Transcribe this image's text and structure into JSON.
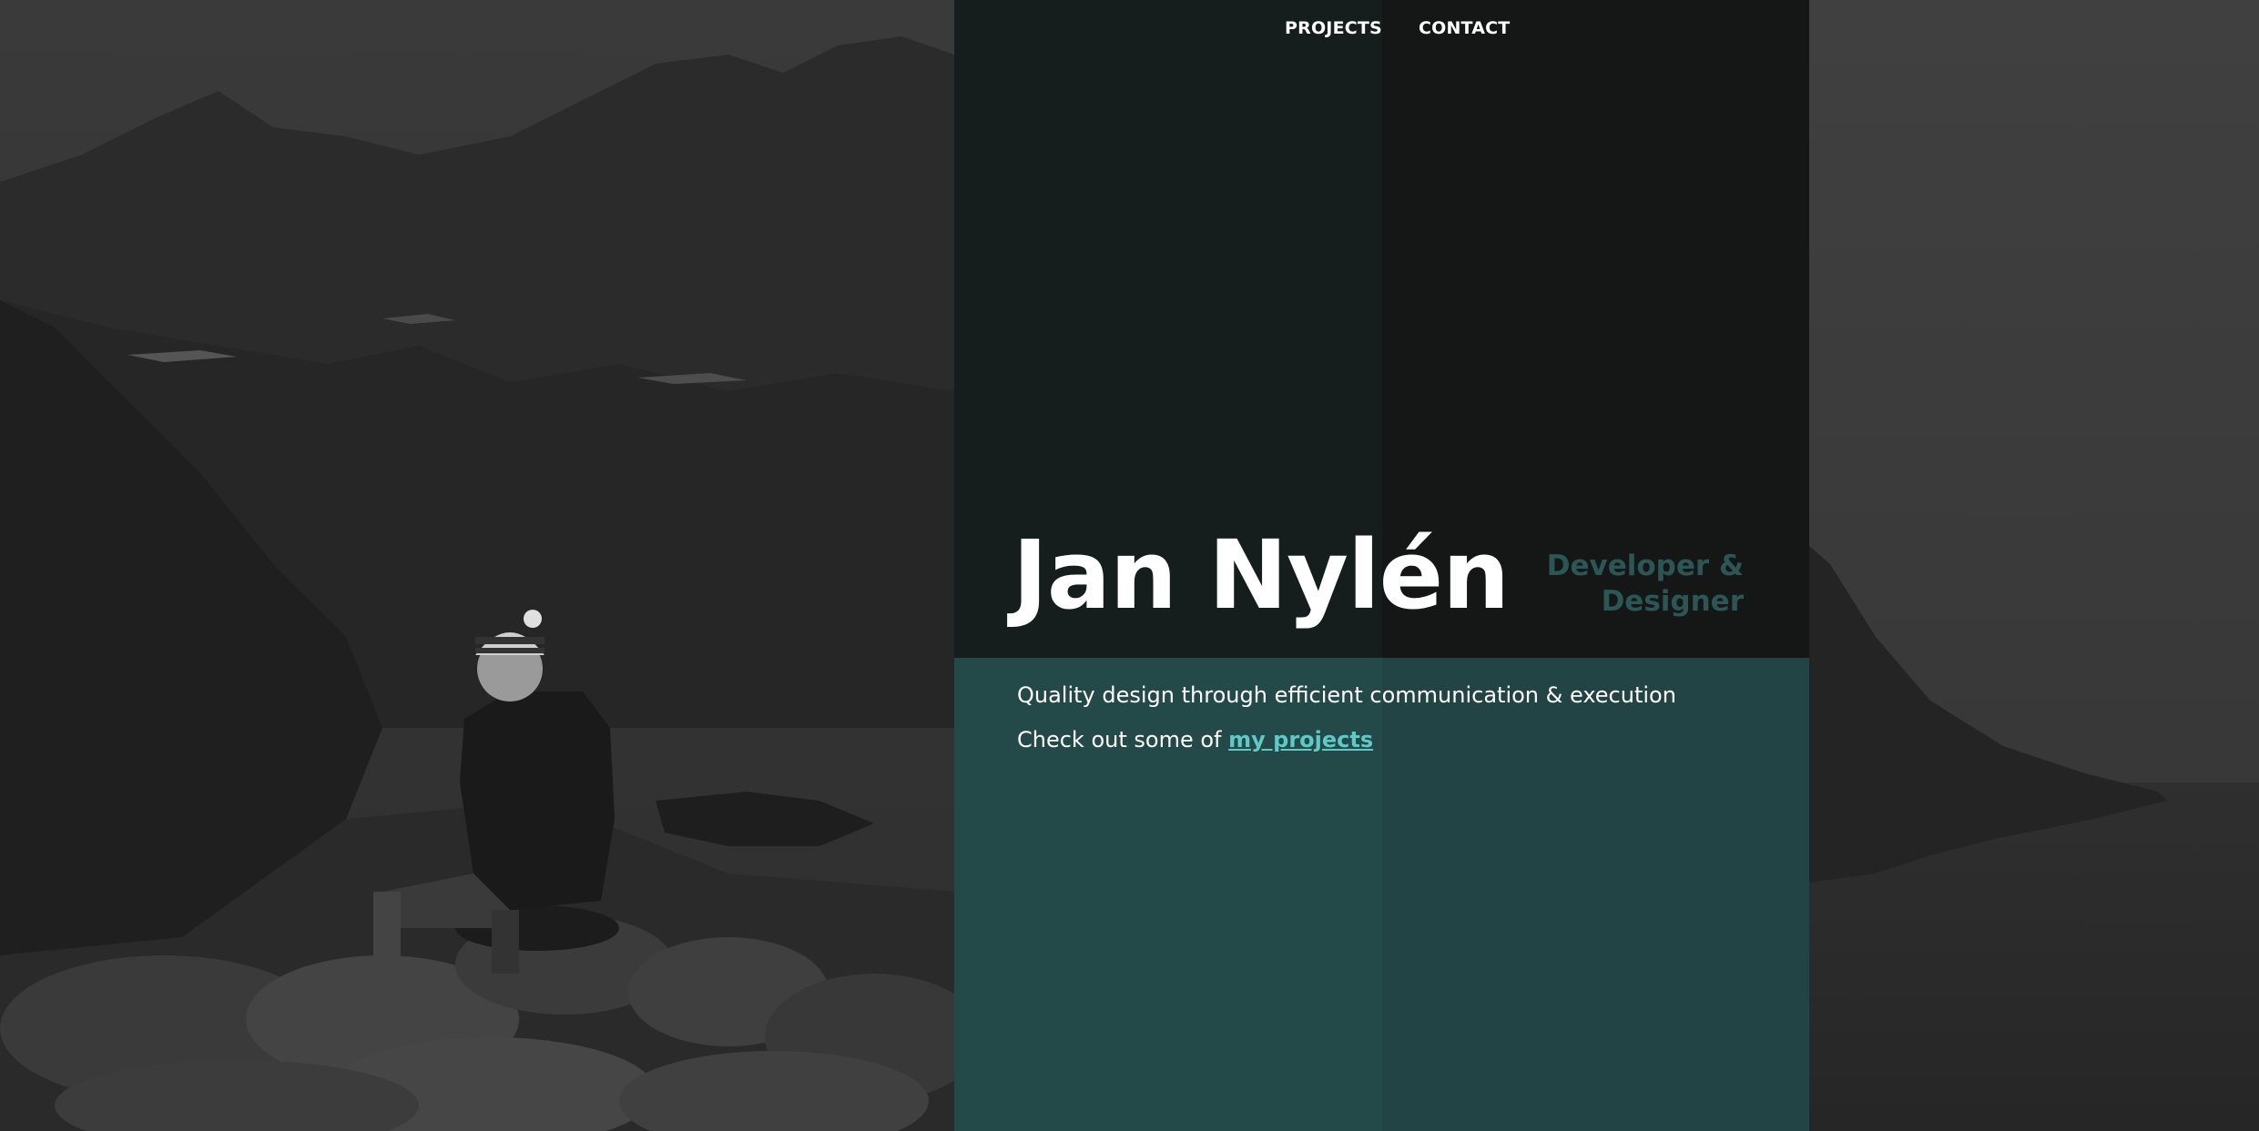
{
  "nav": {
    "items": [
      {
        "label": "PROJECTS"
      },
      {
        "label": "CONTACT"
      }
    ]
  },
  "hero": {
    "name": "Jan Nylén",
    "role_line1": "Developer &",
    "role_line2": "Designer",
    "tagline": "Quality design through efficient communication & execution",
    "cta_prefix": "Check out some of ",
    "cta_link": "my projects"
  },
  "colors": {
    "accent": "#5fc9c6",
    "panel_bottom": "#234444",
    "panel_top": "#141616",
    "role_text": "#2c5656"
  },
  "background": {
    "image": "black-and-white-mountain-landscape-with-seated-hiker"
  }
}
